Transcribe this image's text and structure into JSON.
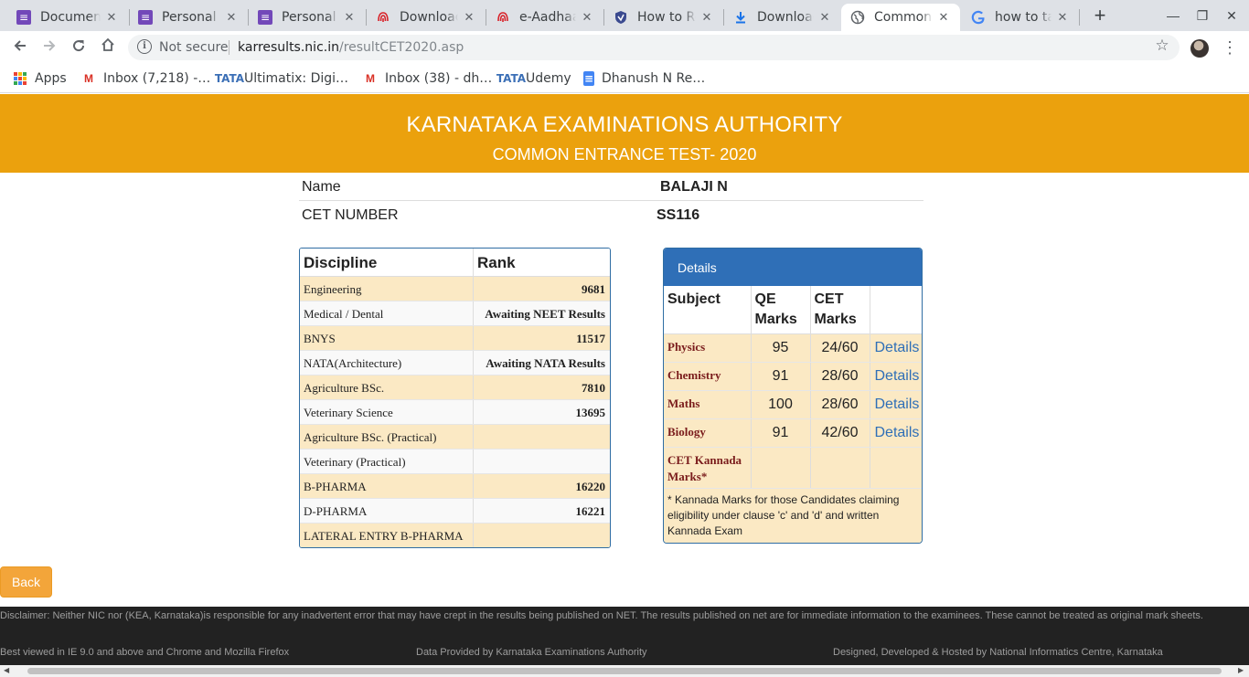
{
  "browser": {
    "tabs": [
      {
        "title": "Documen",
        "icon": "forms-icon"
      },
      {
        "title": "Personal c",
        "icon": "forms-icon"
      },
      {
        "title": "Personal c",
        "icon": "forms-icon"
      },
      {
        "title": "Downloac",
        "icon": "aadhaar-icon"
      },
      {
        "title": "e-Aadhaar",
        "icon": "aadhaar-icon"
      },
      {
        "title": "How to Re",
        "icon": "shield-icon"
      },
      {
        "title": "Downloac",
        "icon": "download-icon"
      },
      {
        "title": "Common",
        "icon": "globe-icon",
        "active": true
      },
      {
        "title": "how to ta",
        "icon": "google-icon"
      }
    ],
    "omnibox": {
      "security": "Not secure",
      "host": "karresults.nic.in",
      "path": "/resultCET2020.asp"
    },
    "bookmarks": [
      {
        "label": "Apps",
        "icon": "apps-icon"
      },
      {
        "label": "Inbox (7,218) -…",
        "icon": "gmail-icon"
      },
      {
        "label": "Ultimatix: Digi…",
        "icon": "tata-icon"
      },
      {
        "label": "Inbox (38) - dh…",
        "icon": "gmail-icon"
      },
      {
        "label": "Udemy",
        "icon": "tata-icon"
      },
      {
        "label": "Dhanush N Re…",
        "icon": "docs-icon"
      }
    ]
  },
  "page": {
    "title": "KARNATAKA EXAMINATIONS AUTHORITY",
    "subtitle": "COMMON ENTRANCE TEST- 2020",
    "candidate": {
      "name_label": "Name",
      "name_value": "BALAJI N",
      "cet_label": "CET NUMBER",
      "cet_value": "SS116"
    },
    "rank_table": {
      "headers": [
        "Discipline",
        "Rank"
      ],
      "rows": [
        {
          "discipline": "Engineering",
          "rank": "9681"
        },
        {
          "discipline": "Medical / Dental",
          "rank": "Awaiting NEET Results"
        },
        {
          "discipline": "BNYS",
          "rank": "11517"
        },
        {
          "discipline": "NATA(Architecture)",
          "rank": "Awaiting NATA Results"
        },
        {
          "discipline": "Agriculture BSc.",
          "rank": "7810"
        },
        {
          "discipline": "Veterinary Science",
          "rank": "13695"
        },
        {
          "discipline": "Agriculture BSc. (Practical)",
          "rank": ""
        },
        {
          "discipline": "Veterinary (Practical)",
          "rank": ""
        },
        {
          "discipline": "B-PHARMA",
          "rank": "16220"
        },
        {
          "discipline": "D-PHARMA",
          "rank": "16221"
        },
        {
          "discipline": "LATERAL ENTRY B-PHARMA",
          "rank": ""
        }
      ]
    },
    "details": {
      "heading": "Details",
      "headers": [
        "Subject",
        "QE Marks",
        "CET Marks",
        ""
      ],
      "rows": [
        {
          "subject": "Physics",
          "qe": "95",
          "cet": "24/60",
          "link": "Details"
        },
        {
          "subject": "Chemistry",
          "qe": "91",
          "cet": "28/60",
          "link": "Details"
        },
        {
          "subject": "Maths",
          "qe": "100",
          "cet": "28/60",
          "link": "Details"
        },
        {
          "subject": "Biology",
          "qe": "91",
          "cet": "42/60",
          "link": "Details"
        },
        {
          "subject": "CET Kannada Marks*",
          "qe": "",
          "cet": "",
          "link": ""
        }
      ],
      "note": "* Kannada Marks for those Candidates claiming eligibility under clause 'c' and 'd' and written Kannada Exam"
    },
    "back_label": "Back",
    "footer": {
      "disclaimer": "Disclaimer: Neither NIC  nor (KEA, Karnataka)is responsible for any inadvertent error that may have crept in the results being published on NET. The results published on net are for immediate information to the examinees. These cannot be treated as original mark sheets.",
      "browsers": "Best viewed in IE 9.0 and above and Chrome and Mozilla Firefox",
      "provider": "Data Provided by Karnataka Examinations Authority",
      "credits": "Designed, Developed & Hosted by National Informatics Centre, Karnataka"
    }
  },
  "colors": {
    "banner": "#eba10d",
    "panel_border": "#2f6da3",
    "details_header": "#2f6fb7",
    "row_highlight": "#fbe9c4",
    "subject_text": "#7a1c1c",
    "footer_bg": "#222222",
    "back_button": "#f3a53a"
  }
}
